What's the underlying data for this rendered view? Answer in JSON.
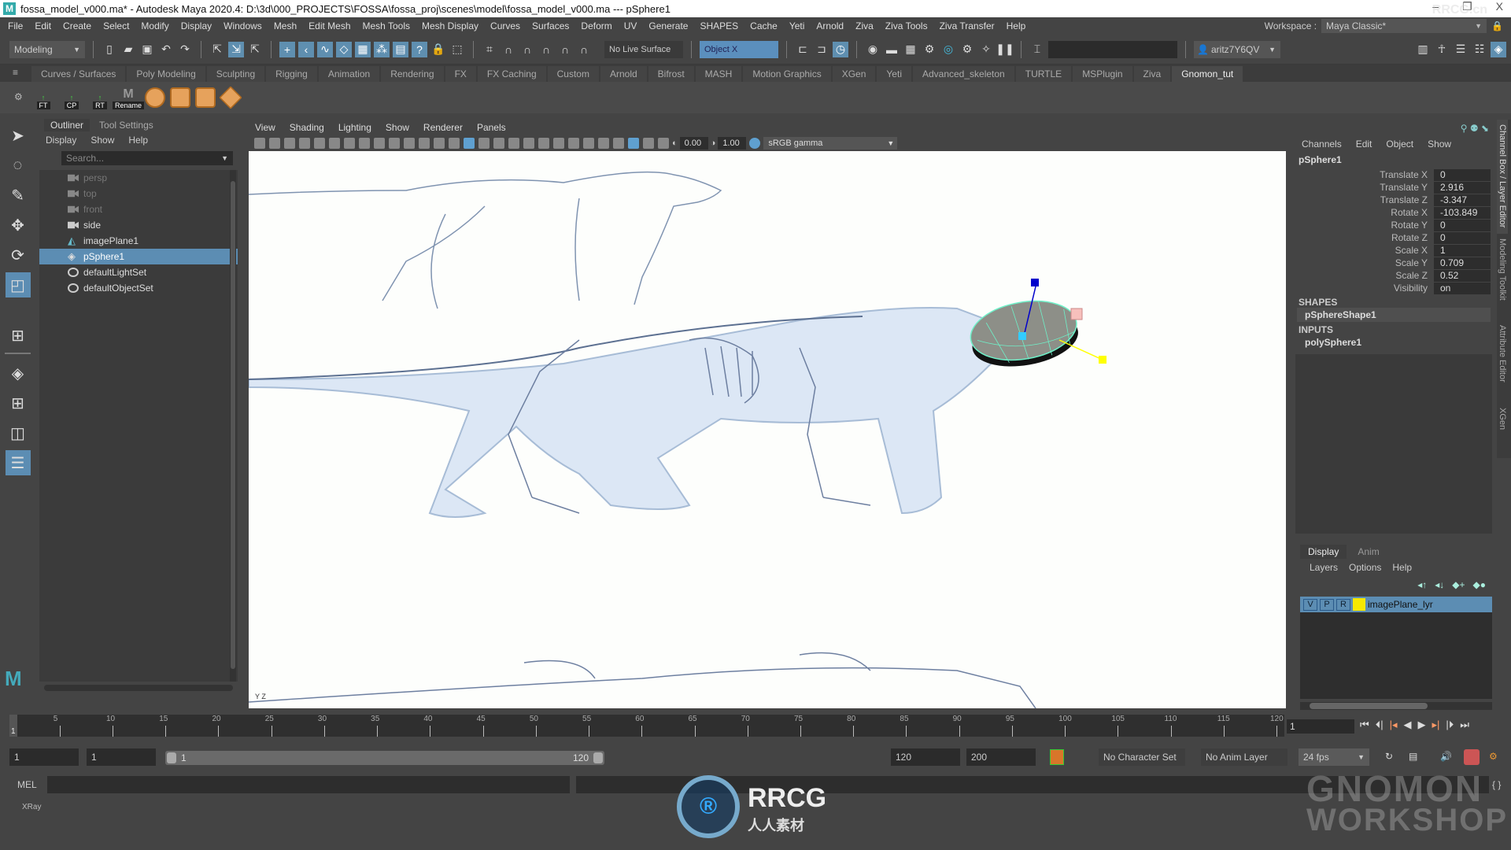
{
  "window": {
    "title": "fossa_model_v000.ma* - Autodesk Maya 2020.4: D:\\3d\\000_PROJECTS\\FOSSA\\fossa_proj\\scenes\\model\\fossa_model_v000.ma   ---   pSphere1",
    "minimize": "–",
    "restore": "❐",
    "close": "X"
  },
  "menubar": [
    "File",
    "Edit",
    "Create",
    "Select",
    "Modify",
    "Display",
    "Windows",
    "Mesh",
    "Edit Mesh",
    "Mesh Tools",
    "Mesh Display",
    "Curves",
    "Surfaces",
    "Deform",
    "UV",
    "Generate",
    "SHAPES",
    "Cache",
    "Yeti",
    "Arnold",
    "Ziva",
    "Ziva Tools",
    "Ziva Transfer",
    "Help"
  ],
  "workspace": {
    "label": "Workspace :",
    "value": "Maya Classic*"
  },
  "statusline": {
    "menuset": "Modeling",
    "live_surface": "No Live Surface",
    "symmetry": "Object X",
    "user": "aritz7Y6QV"
  },
  "shelf": {
    "tabs": [
      "Curves / Surfaces",
      "Poly Modeling",
      "Sculpting",
      "Rigging",
      "Animation",
      "Rendering",
      "FX",
      "FX Caching",
      "Custom",
      "Arnold",
      "Bifrost",
      "MASH",
      "Motion Graphics",
      "XGen",
      "Yeti",
      "Advanced_skeleton",
      "TURTLE",
      "MSPlugin",
      "Ziva",
      "Gnomon_tut"
    ],
    "active_tab": "Gnomon_tut",
    "buttons": [
      {
        "label": "FT",
        "icon": "freeze-transform-icon"
      },
      {
        "label": "CP",
        "icon": "center-pivot-icon"
      },
      {
        "label": "RT",
        "icon": "reset-transform-icon"
      },
      {
        "label": "Rename",
        "icon": "rename-icon"
      }
    ]
  },
  "outliner": {
    "tabs": [
      "Outliner",
      "Tool Settings"
    ],
    "menu": [
      "Display",
      "Show",
      "Help"
    ],
    "search_placeholder": "Search...",
    "items": [
      {
        "name": "persp",
        "type": "camera",
        "dim": true
      },
      {
        "name": "top",
        "type": "camera",
        "dim": true
      },
      {
        "name": "front",
        "type": "camera",
        "dim": true
      },
      {
        "name": "side",
        "type": "camera",
        "dim": false
      },
      {
        "name": "imagePlane1",
        "type": "imageplane",
        "dim": false
      },
      {
        "name": "pSphere1",
        "type": "mesh",
        "dim": false,
        "selected": true
      },
      {
        "name": "defaultLightSet",
        "type": "set",
        "dim": false
      },
      {
        "name": "defaultObjectSet",
        "type": "set",
        "dim": false
      }
    ]
  },
  "viewport": {
    "menu": [
      "View",
      "Shading",
      "Lighting",
      "Show",
      "Renderer",
      "Panels"
    ],
    "exposure": "0.00",
    "gamma": "1.00",
    "color_space": "sRGB gamma",
    "axis_label": "Y Z"
  },
  "channelbox": {
    "menu": [
      "Channels",
      "Edit",
      "Object",
      "Show"
    ],
    "object": "pSphere1",
    "attributes": [
      {
        "name": "Translate X",
        "value": "0"
      },
      {
        "name": "Translate Y",
        "value": "2.916"
      },
      {
        "name": "Translate Z",
        "value": "-3.347"
      },
      {
        "name": "Rotate X",
        "value": "-103.849"
      },
      {
        "name": "Rotate Y",
        "value": "0"
      },
      {
        "name": "Rotate Z",
        "value": "0"
      },
      {
        "name": "Scale X",
        "value": "1"
      },
      {
        "name": "Scale Y",
        "value": "0.709"
      },
      {
        "name": "Scale Z",
        "value": "0.52"
      },
      {
        "name": "Visibility",
        "value": "on"
      }
    ],
    "shapes_label": "SHAPES",
    "shape": "pSphereShape1",
    "inputs_label": "INPUTS",
    "input": "polySphere1"
  },
  "side_tabs": [
    "Channel Box / Layer Editor",
    "Modeling Toolkit",
    "Attribute Editor",
    "XGen"
  ],
  "layer_editor": {
    "tabs": [
      "Display",
      "Anim"
    ],
    "menu": [
      "Layers",
      "Options",
      "Help"
    ],
    "layers": [
      {
        "v": "V",
        "p": "P",
        "r": "R",
        "color": "#f5e800",
        "name": "imagePlane_lyr"
      }
    ]
  },
  "timeline": {
    "ticks": [
      5,
      10,
      15,
      20,
      25,
      30,
      35,
      40,
      45,
      50,
      55,
      60,
      65,
      70,
      75,
      80,
      85,
      90,
      95,
      100,
      105,
      110,
      115,
      120
    ],
    "start": 1,
    "end": 120,
    "current_frame": "1"
  },
  "range": {
    "start": "1",
    "anim_start": "1",
    "slider_start": "1",
    "slider_end": "120",
    "end": "120",
    "anim_end": "200",
    "character_set": "No Character Set",
    "anim_layer": "No Anim Layer",
    "fps": "24 fps"
  },
  "command": {
    "label": "MEL"
  },
  "helpline": "XRay",
  "watermarks": {
    "rrcg": "RRCG",
    "rrcg_sub": "人人素材",
    "gnomon": "GNOMON",
    "workshop": "WORKSHOP",
    "rrcg_top": "RRCG.cn"
  }
}
